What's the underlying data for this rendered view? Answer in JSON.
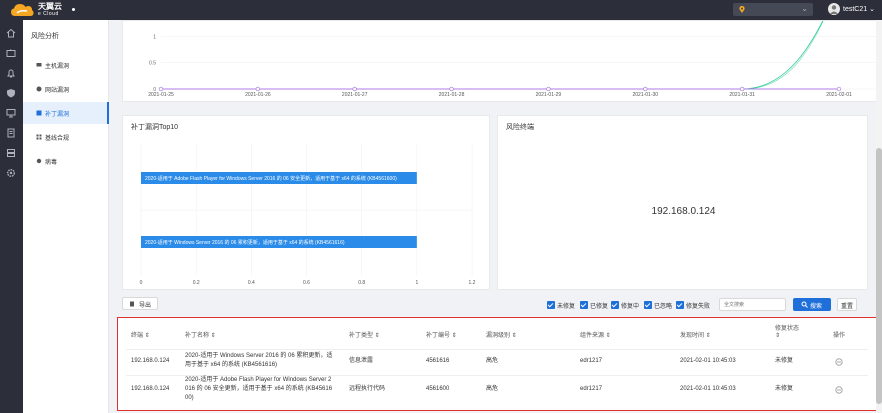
{
  "brand": {
    "name": "天翼云",
    "sub": "e Cloud"
  },
  "topbar": {
    "region_placeholder": "",
    "user": "testC21"
  },
  "sidebar": {
    "title": "风险分析",
    "items": [
      {
        "label": "主机漏洞",
        "active": false
      },
      {
        "label": "网站漏洞",
        "active": false
      },
      {
        "label": "补丁漏洞",
        "active": true
      },
      {
        "label": "基线合规",
        "active": false
      },
      {
        "label": "病毒",
        "active": false
      }
    ]
  },
  "line_chart": {
    "type": "line",
    "yticks": [
      "1",
      "0.5",
      "0"
    ],
    "x": [
      "2021-01-25",
      "2021-01-26",
      "2021-01-27",
      "2021-01-28",
      "2021-01-29",
      "2021-01-30",
      "2021-01-31",
      "2021-02-01"
    ],
    "series": [
      {
        "color": "#3fcf9e",
        "values": [
          0,
          0,
          0,
          0,
          0,
          0,
          0,
          2
        ]
      },
      {
        "color": "#b27ae8",
        "values": [
          0,
          0,
          0,
          0,
          0,
          0,
          0,
          0
        ]
      }
    ]
  },
  "bar_card": {
    "title": "补丁漏洞Top10"
  },
  "chart_data": {
    "type": "bar",
    "orientation": "horizontal",
    "categories": [
      "2020-适用于 Adobe Flash Player for Windows Server 2016 的 06 安全更新，适用于基于 x64 的系统 (KB4561600)",
      "2020-适用于 Windows Server 2016 的 06 累积更新，适用于基于 x64 的系统 (KB4561616)"
    ],
    "values": [
      1,
      1
    ],
    "xticks": [
      "0",
      "0.2",
      "0.4",
      "0.6",
      "0.8",
      "1",
      "1.2"
    ],
    "xlim": [
      0,
      1.2
    ],
    "color": "#2a8be8"
  },
  "risk_card": {
    "title": "风险终端",
    "ip": "192.168.0.124"
  },
  "toolbar": {
    "export": "导出",
    "filters": [
      {
        "label": "未修复",
        "checked": true
      },
      {
        "label": "已修复",
        "checked": true
      },
      {
        "label": "修复中",
        "checked": true
      },
      {
        "label": "已忽略",
        "checked": true
      },
      {
        "label": "修复失败",
        "checked": true
      }
    ],
    "search_placeholder": "全文搜索",
    "search": "搜索",
    "reset": "重置"
  },
  "table": {
    "headers": [
      "终端",
      "补丁名称",
      "补丁类型",
      "补丁编号",
      "漏洞级别",
      "组件来源",
      "发现时间",
      "修复状态",
      "操作"
    ],
    "rows": [
      {
        "terminal": "192.168.0.124",
        "name": [
          "2020-适用于 Windows Server 2016 的 06 累积更新，适",
          "用于基于 x64 的系统 (KB4561616)"
        ],
        "type": "信息泄露",
        "id": "4561616",
        "level": "高危",
        "source": "edr1217",
        "time": "2021-02-01 10:45:03",
        "status": "未修复"
      },
      {
        "terminal": "192.168.0.124",
        "name": [
          "2020-适用于 Adobe Flash Player for Windows Server 2",
          "016 的 06 安全更新，适用于基于 x64 的系统 (KB45616",
          "00)"
        ],
        "type": "远程执行代码",
        "id": "4561600",
        "level": "高危",
        "source": "edr1217",
        "time": "2021-02-01 10:45:03",
        "status": "未修复"
      }
    ]
  },
  "colors": {
    "accent": "#1e6fd9",
    "topbar": "#2c2f3a",
    "highlight": "#e03030"
  }
}
